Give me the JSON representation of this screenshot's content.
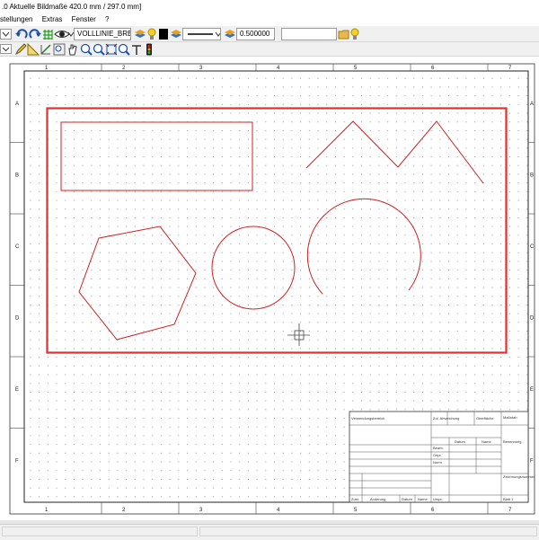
{
  "titlebar": {
    "text": ".0   Aktuelle Bildmaße 420.0 mm / 297.0 mm]"
  },
  "menu": [
    "stellungen",
    "Extras",
    "Fenster",
    "?"
  ],
  "toolbar": {
    "line_type_value": "VOLLLINIE_BREIT",
    "line_width_value": "0.500000",
    "search_value": ""
  },
  "sheet": {
    "columns": [
      "1",
      "2",
      "3",
      "4",
      "5",
      "6",
      "7"
    ],
    "rows": [
      "A",
      "B",
      "C",
      "D",
      "E",
      "F"
    ]
  },
  "title_block": {
    "cells": [
      "Verwendungsbereich",
      "Zul. Abweichung",
      "Oberfläche",
      "Maßstab",
      "Datum",
      "Name",
      "Benennung",
      "Bearb.",
      "Gepr.",
      "Norm",
      "Zeichnungsnummer",
      "Zust.",
      "Änderung",
      "Datum",
      "Name",
      "Urspr.",
      "Blatt 1"
    ]
  },
  "colors": {
    "drawing": "#cc2222",
    "selection": "#e03030"
  }
}
